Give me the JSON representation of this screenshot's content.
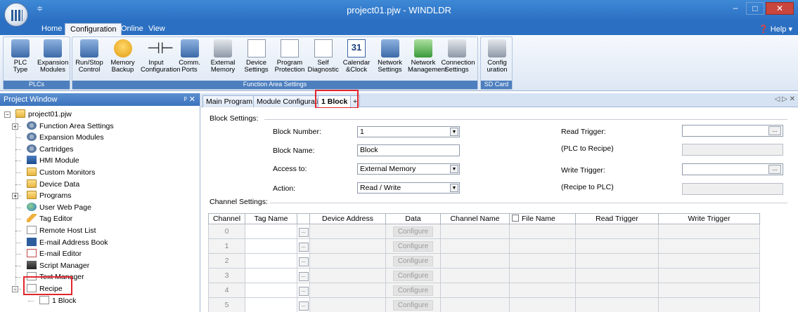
{
  "window": {
    "title": "project01.pjw - WINDLDR",
    "qat_glyph": "≑",
    "minimize": "–",
    "maximize": "□",
    "close": "✕"
  },
  "ribbon_tabs": [
    "Home",
    "Configuration",
    "Online",
    "View"
  ],
  "help_label": "Help ▾",
  "ribbon_groups": {
    "plcs": {
      "label": "PLCs",
      "buttons": [
        {
          "label": "PLC\nType",
          "icon": "plc-icon"
        },
        {
          "label": "Expansion\nModules",
          "icon": "expansion-modules-icon"
        }
      ]
    },
    "function_area": {
      "label": "Function Area Settings",
      "buttons": [
        {
          "label": "Run/Stop\nControl",
          "icon": "run-stop-icon"
        },
        {
          "label": "Memory\nBackup",
          "icon": "memory-backup-icon"
        },
        {
          "label": "Input\nConfiguration",
          "icon": "input-config-icon"
        },
        {
          "label": "Comm.\nPorts",
          "icon": "comm-ports-icon"
        },
        {
          "label": "External\nMemory",
          "icon": "external-memory-icon"
        },
        {
          "label": "Device\nSettings",
          "icon": "device-settings-icon"
        },
        {
          "label": "Program\nProtection",
          "icon": "program-protection-icon"
        },
        {
          "label": "Self\nDiagnostic",
          "icon": "self-diagnostic-icon"
        },
        {
          "label": "Calendar\n&Clock",
          "icon": "calendar-icon",
          "glyph": "31"
        },
        {
          "label": "Network\nSettings",
          "icon": "network-settings-icon"
        },
        {
          "label": "Network\nManagement",
          "icon": "network-management-icon"
        },
        {
          "label": "Connection\nSettings",
          "icon": "connection-settings-icon"
        }
      ]
    },
    "sd_card": {
      "label": "SD Card",
      "buttons": [
        {
          "label": "Config\nuration",
          "icon": "sd-config-icon"
        }
      ]
    }
  },
  "project_window": {
    "title": "Project Window",
    "pin": "ᵖ ✕",
    "tree": [
      {
        "label": "project01.pjw",
        "icon": "folder",
        "level": 0
      },
      {
        "label": "Function Area Settings",
        "icon": "gear",
        "level": 1
      },
      {
        "label": "Expansion Modules",
        "icon": "gear",
        "level": 1
      },
      {
        "label": "Cartridges",
        "icon": "gear",
        "level": 1
      },
      {
        "label": "HMI Module",
        "icon": "dev",
        "level": 1
      },
      {
        "label": "Custom Monitors",
        "icon": "folder",
        "level": 1
      },
      {
        "label": "Device Data",
        "icon": "folder",
        "level": 1
      },
      {
        "label": "Programs",
        "icon": "folder",
        "level": 1
      },
      {
        "label": "User Web Page",
        "icon": "globe",
        "level": 1
      },
      {
        "label": "Tag Editor",
        "icon": "pencil",
        "level": 1
      },
      {
        "label": "Remote Host List",
        "icon": "doc",
        "level": 1
      },
      {
        "label": "E-mail Address Book",
        "icon": "book",
        "level": 1
      },
      {
        "label": "E-mail Editor",
        "icon": "mail",
        "level": 1
      },
      {
        "label": "Script Manager",
        "icon": "script",
        "level": 1
      },
      {
        "label": "Text Manager",
        "icon": "doc",
        "level": 1
      },
      {
        "label": "Recipe",
        "icon": "doc",
        "level": 1
      },
      {
        "label": "1 Block",
        "icon": "doc",
        "level": 2
      }
    ]
  },
  "doc_tabs": [
    "Main Program",
    "Module Configuratio",
    "1 Block",
    "+"
  ],
  "doc_nav": "◁ ▷ ✕",
  "block_settings": {
    "section_label": "Block Settings:",
    "block_number_label": "Block Number:",
    "block_number_value": "1",
    "block_name_label": "Block Name:",
    "block_name_value": "Block",
    "access_to_label": "Access to:",
    "access_to_value": "External Memory",
    "action_label": "Action:",
    "action_value": "Read / Write",
    "read_trigger_label": "Read Trigger:",
    "read_trigger_value": "",
    "plc_to_recipe_label": "(PLC to Recipe)",
    "write_trigger_label": "Write Trigger:",
    "write_trigger_value": "",
    "recipe_to_plc_label": "(Recipe to PLC)",
    "ellipsis": "..."
  },
  "channel_settings": {
    "section_label": "Channel Settings:",
    "columns": [
      "Channel",
      "Tag Name",
      "",
      "Device Address",
      "Data",
      "Channel Name",
      "",
      "File Name",
      "Read Trigger",
      "Write Trigger"
    ],
    "configure_label": "Configure",
    "rows": [
      "0",
      "1",
      "2",
      "3",
      "4",
      "5"
    ]
  },
  "colors": {
    "accent": "#2b6fc2",
    "highlight": "#e1262d"
  }
}
